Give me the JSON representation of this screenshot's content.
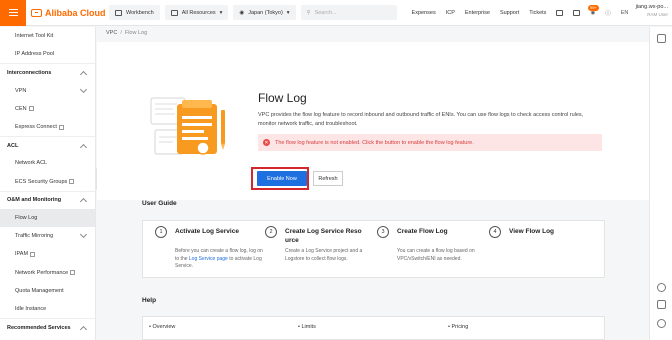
{
  "topbar": {
    "brand": "Alibaba Cloud",
    "workbench": "Workbench",
    "resources": "All Resources",
    "region": "Japan (Tokyo)",
    "search_placeholder": "Search...",
    "links": [
      "Expenses",
      "ICP",
      "Enterprise",
      "Support",
      "Tickets"
    ],
    "badge": "99+",
    "lang": "EN",
    "account_name": "jiang.wx-po...",
    "account_role": "RAM User"
  },
  "sidebar": {
    "items": [
      {
        "label": "Internet Tool Kit",
        "type": "item"
      },
      {
        "label": "IP Address Pool",
        "type": "item"
      },
      {
        "label": "Interconnections",
        "type": "group"
      },
      {
        "label": "VPN",
        "type": "item",
        "chevron": true
      },
      {
        "label": "CEN",
        "type": "item",
        "ext": true
      },
      {
        "label": "Express Connect",
        "type": "item",
        "ext": true
      },
      {
        "label": "ACL",
        "type": "group"
      },
      {
        "label": "Network ACL",
        "type": "item"
      },
      {
        "label": "ECS Security Groups",
        "type": "item",
        "ext": true
      },
      {
        "label": "O&M and Monitoring",
        "type": "group"
      },
      {
        "label": "Flow Log",
        "type": "item",
        "active": true
      },
      {
        "label": "Traffic Mirroring",
        "type": "item",
        "chevron": true
      },
      {
        "label": "IPAM",
        "type": "item",
        "ext": true
      },
      {
        "label": "Network Performance",
        "type": "item",
        "ext": true
      },
      {
        "label": "Quota Management",
        "type": "item"
      },
      {
        "label": "Idle Instance",
        "type": "item"
      },
      {
        "label": "Recommended Services",
        "type": "group"
      }
    ]
  },
  "breadcrumb": {
    "root": "VPC",
    "sep": "/",
    "current": "Flow Log"
  },
  "hero": {
    "title": "Flow Log",
    "description": "VPC provides the flow log feature to record inbound and outbound traffic of ENIs. You can use flow logs to check access control rules, monitor network traffic, and troubleshoot.",
    "alert": "The flow log feature is not enabled. Click the button to enable the flow log feature.",
    "enable_button": "Enable Now",
    "refresh_button": "Refresh"
  },
  "guide": {
    "title": "User Guide",
    "steps": [
      {
        "num": "1",
        "title": "Activate Log Service",
        "desc_pre": "Before you can create a flow log, log on to the ",
        "desc_link": "Log Service page",
        "desc_post": " to activate Log Service."
      },
      {
        "num": "2",
        "title": "Create Log Service Reso",
        "title2": "urce",
        "desc_pre": "Create a Log Service project and a Logstore to collect flow logs.",
        "desc_link": "",
        "desc_post": ""
      },
      {
        "num": "3",
        "title": "Create Flow Log",
        "desc_pre": "You can create a flow log based on VPC/vSwitch/ENI as needed.",
        "desc_link": "",
        "desc_post": ""
      },
      {
        "num": "4",
        "title": "View Flow Log",
        "desc_pre": "",
        "desc_link": "",
        "desc_post": ""
      }
    ]
  },
  "help": {
    "title": "Help",
    "items": [
      "Overview",
      "Limits",
      "Pricing"
    ]
  },
  "colors": {
    "brand": "#ff6a00",
    "primary": "#1e6fe0",
    "error": "#d63c3c",
    "highlight": "#d4262d"
  }
}
